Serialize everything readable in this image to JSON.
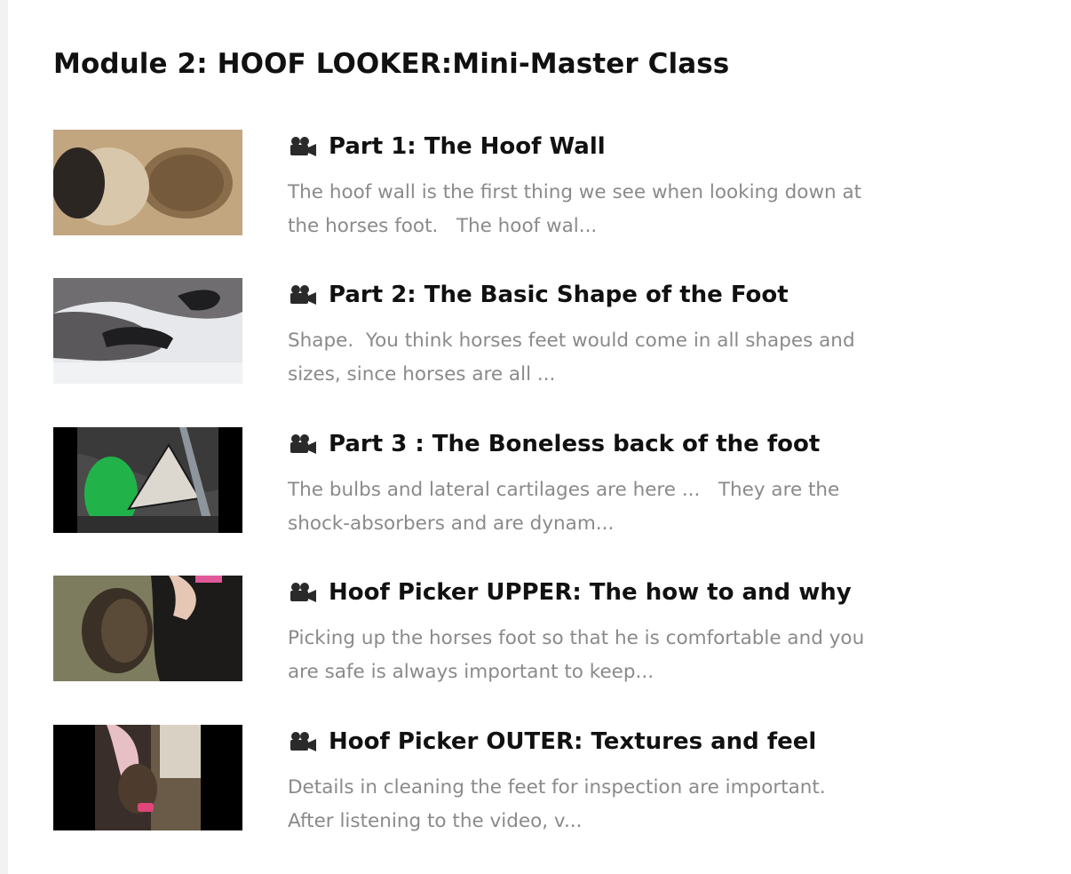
{
  "module": {
    "title": "Module 2: HOOF LOOKER:Mini-Master Class"
  },
  "lessons": [
    {
      "icon": "movie-camera-icon",
      "title": "Part 1: The Hoof Wall",
      "description": "The hoof wall is the first thing we see when looking down at\nthe horses foot.   The hoof wal..."
    },
    {
      "icon": "movie-camera-icon",
      "title": "Part 2: The Basic Shape of the Foot",
      "description": "Shape.  You think horses feet would come in all shapes and\nsizes, since horses are all ..."
    },
    {
      "icon": "movie-camera-icon",
      "title": "Part 3 : The Boneless back of the foot",
      "description": "The bulbs and lateral cartilages are here ...   They are the\nshock-absorbers and are dynam..."
    },
    {
      "icon": "movie-camera-icon",
      "title": "Hoof Picker UPPER: The how to and why",
      "description": "Picking up the horses foot so that he is comfortable and you\nare safe is always important to keep..."
    },
    {
      "icon": "movie-camera-icon",
      "title": "Hoof Picker OUTER: Textures and feel",
      "description": "Details in cleaning the feet for inspection are important.\nAfter listening to the video, v..."
    }
  ]
}
